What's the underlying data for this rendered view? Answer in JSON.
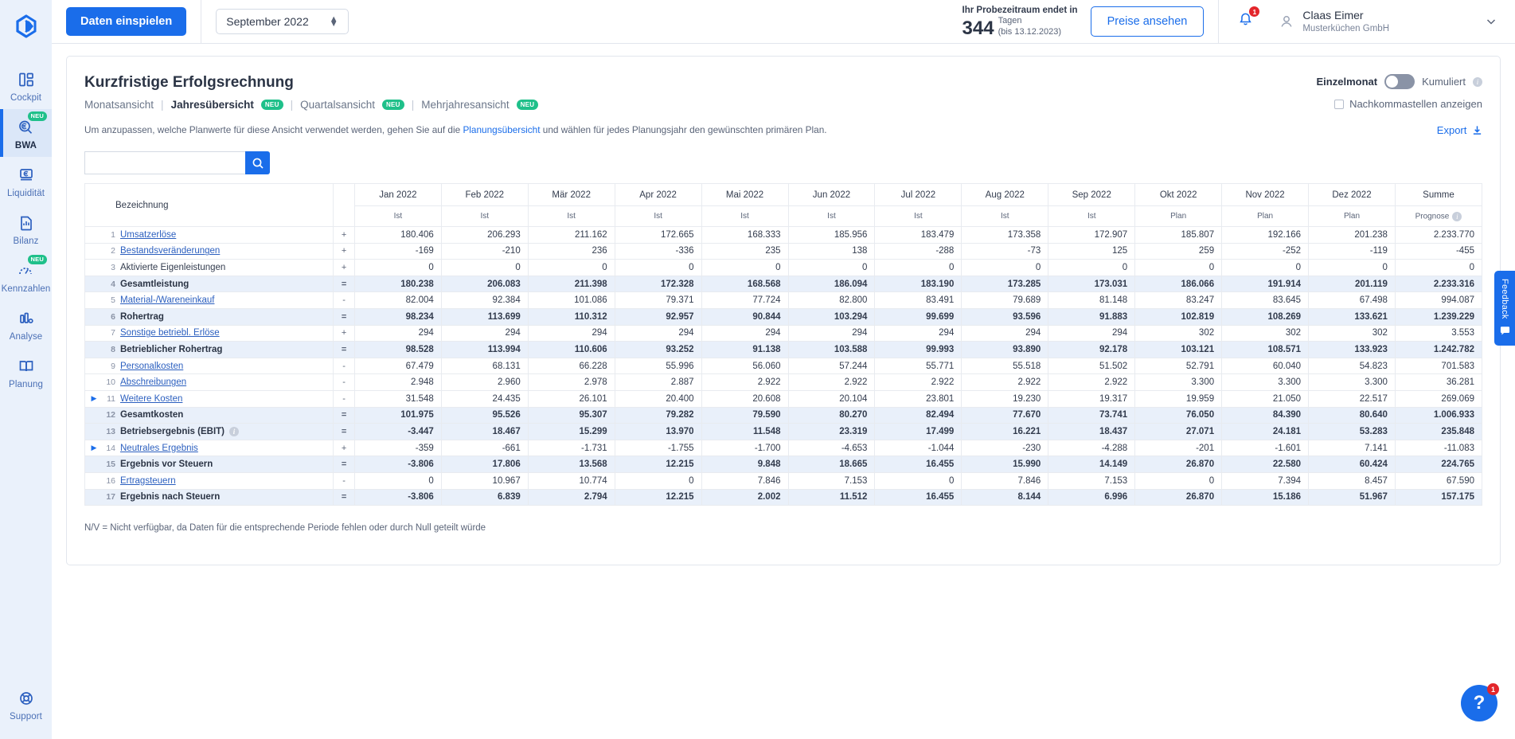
{
  "sidebar": {
    "logo": "agicap-logo",
    "items": [
      {
        "label": "Cockpit",
        "icon": "cockpit-icon",
        "badge": null,
        "active": false
      },
      {
        "label": "BWA",
        "icon": "bwa-magnifier-euro-icon",
        "badge": "NEU",
        "active": true
      },
      {
        "label": "Liquidität",
        "icon": "liquiditaet-atm-icon",
        "badge": null,
        "active": false
      },
      {
        "label": "Bilanz",
        "icon": "bilanz-document-icon",
        "badge": null,
        "active": false
      },
      {
        "label": "Kennzahlen",
        "icon": "kennzahlen-gauge-icon",
        "badge": "NEU",
        "active": false
      },
      {
        "label": "Analyse",
        "icon": "analyse-bars-icon",
        "badge": null,
        "active": false
      },
      {
        "label": "Planung",
        "icon": "planung-book-icon",
        "badge": null,
        "active": false
      }
    ],
    "support": {
      "label": "Support",
      "icon": "support-lifebuoy-icon"
    }
  },
  "topbar": {
    "import_button": "Daten einspielen",
    "month_select": "September 2022",
    "trial_heading": "Ihr Probezeitraum endet in",
    "trial_days": "344",
    "trial_unit": "Tagen",
    "trial_until": "(bis 13.12.2023)",
    "prices_button": "Preise ansehen",
    "bell_icon": "notification-bell-icon",
    "bell_count": "1",
    "avatar_icon": "user-avatar-icon",
    "user_name": "Claas Eimer",
    "user_org": "Musterküchen GmbH",
    "chevron": "chevron-down-icon"
  },
  "page": {
    "title": "Kurzfristige Erfolgsrechnung",
    "tabs": [
      {
        "label": "Monatsansicht",
        "badge": null,
        "active": false
      },
      {
        "label": "Jahresübersicht",
        "badge": "NEU",
        "active": true
      },
      {
        "label": "Quartalsansicht",
        "badge": "NEU",
        "active": false
      },
      {
        "label": "Mehrjahresansicht",
        "badge": "NEU",
        "active": false
      }
    ],
    "separator": "|",
    "hint_pre": "Um anzupassen, welche Planwerte für diese Ansicht verwendet werden, gehen Sie auf die ",
    "hint_link": "Planungsübersicht",
    "hint_post": " und wählen für jedes Planungsjahr den gewünschten primären Plan.",
    "toggle_left": "Einzelmonat",
    "toggle_right": "Kumuliert",
    "checkbox_label": "Nachkommastellen anzeigen",
    "export_label": "Export",
    "export_icon": "download-icon",
    "search_placeholder": "",
    "search_value": "",
    "search_icon": "search-icon",
    "footnote": "N/V = Nicht verfügbar, da Daten für die entsprechende Periode fehlen oder durch Null geteilt würde"
  },
  "table": {
    "name_header": "Bezeichnung",
    "columns": [
      {
        "label": "Jan 2022",
        "sub": "Ist"
      },
      {
        "label": "Feb 2022",
        "sub": "Ist"
      },
      {
        "label": "Mär 2022",
        "sub": "Ist"
      },
      {
        "label": "Apr 2022",
        "sub": "Ist"
      },
      {
        "label": "Mai 2022",
        "sub": "Ist"
      },
      {
        "label": "Jun 2022",
        "sub": "Ist"
      },
      {
        "label": "Jul 2022",
        "sub": "Ist"
      },
      {
        "label": "Aug 2022",
        "sub": "Ist"
      },
      {
        "label": "Sep 2022",
        "sub": "Ist"
      },
      {
        "label": "Okt 2022",
        "sub": "Plan"
      },
      {
        "label": "Nov 2022",
        "sub": "Plan"
      },
      {
        "label": "Dez 2022",
        "sub": "Plan"
      },
      {
        "label": "Summe",
        "sub": "Prognose"
      }
    ],
    "rows": [
      {
        "no": "1",
        "label": "Umsatzerlöse",
        "link": true,
        "sign": "+",
        "highlight": false,
        "expandable": false,
        "info": false,
        "values": [
          "180.406",
          "206.293",
          "211.162",
          "172.665",
          "168.333",
          "185.956",
          "183.479",
          "173.358",
          "172.907",
          "185.807",
          "192.166",
          "201.238",
          "2.233.770"
        ]
      },
      {
        "no": "2",
        "label": "Bestandsveränderungen",
        "link": true,
        "sign": "+",
        "highlight": false,
        "expandable": false,
        "info": false,
        "values": [
          "-169",
          "-210",
          "236",
          "-336",
          "235",
          "138",
          "-288",
          "-73",
          "125",
          "259",
          "-252",
          "-119",
          "-455"
        ]
      },
      {
        "no": "3",
        "label": "Aktivierte Eigenleistungen",
        "link": false,
        "sign": "+",
        "highlight": false,
        "expandable": false,
        "info": false,
        "values": [
          "0",
          "0",
          "0",
          "0",
          "0",
          "0",
          "0",
          "0",
          "0",
          "0",
          "0",
          "0",
          "0"
        ]
      },
      {
        "no": "4",
        "label": "Gesamtleistung",
        "link": false,
        "sign": "=",
        "highlight": true,
        "expandable": false,
        "info": false,
        "values": [
          "180.238",
          "206.083",
          "211.398",
          "172.328",
          "168.568",
          "186.094",
          "183.190",
          "173.285",
          "173.031",
          "186.066",
          "191.914",
          "201.119",
          "2.233.316"
        ]
      },
      {
        "no": "5",
        "label": "Material-/Wareneinkauf",
        "link": true,
        "sign": "-",
        "highlight": false,
        "expandable": false,
        "info": false,
        "values": [
          "82.004",
          "92.384",
          "101.086",
          "79.371",
          "77.724",
          "82.800",
          "83.491",
          "79.689",
          "81.148",
          "83.247",
          "83.645",
          "67.498",
          "994.087"
        ]
      },
      {
        "no": "6",
        "label": "Rohertrag",
        "link": false,
        "sign": "=",
        "highlight": true,
        "expandable": false,
        "info": false,
        "values": [
          "98.234",
          "113.699",
          "110.312",
          "92.957",
          "90.844",
          "103.294",
          "99.699",
          "93.596",
          "91.883",
          "102.819",
          "108.269",
          "133.621",
          "1.239.229"
        ]
      },
      {
        "no": "7",
        "label": "Sonstige betriebl. Erlöse",
        "link": true,
        "sign": "+",
        "highlight": false,
        "expandable": false,
        "info": false,
        "values": [
          "294",
          "294",
          "294",
          "294",
          "294",
          "294",
          "294",
          "294",
          "294",
          "302",
          "302",
          "302",
          "3.553"
        ]
      },
      {
        "no": "8",
        "label": "Betrieblicher Rohertrag",
        "link": false,
        "sign": "=",
        "highlight": true,
        "expandable": false,
        "info": false,
        "values": [
          "98.528",
          "113.994",
          "110.606",
          "93.252",
          "91.138",
          "103.588",
          "99.993",
          "93.890",
          "92.178",
          "103.121",
          "108.571",
          "133.923",
          "1.242.782"
        ]
      },
      {
        "no": "9",
        "label": "Personalkosten",
        "link": true,
        "sign": "-",
        "highlight": false,
        "expandable": false,
        "info": false,
        "values": [
          "67.479",
          "68.131",
          "66.228",
          "55.996",
          "56.060",
          "57.244",
          "55.771",
          "55.518",
          "51.502",
          "52.791",
          "60.040",
          "54.823",
          "701.583"
        ]
      },
      {
        "no": "10",
        "label": "Abschreibungen",
        "link": true,
        "sign": "-",
        "highlight": false,
        "expandable": false,
        "info": false,
        "values": [
          "2.948",
          "2.960",
          "2.978",
          "2.887",
          "2.922",
          "2.922",
          "2.922",
          "2.922",
          "2.922",
          "3.300",
          "3.300",
          "3.300",
          "36.281"
        ]
      },
      {
        "no": "11",
        "label": "Weitere Kosten",
        "link": true,
        "sign": "-",
        "highlight": false,
        "expandable": true,
        "info": false,
        "values": [
          "31.548",
          "24.435",
          "26.101",
          "20.400",
          "20.608",
          "20.104",
          "23.801",
          "19.230",
          "19.317",
          "19.959",
          "21.050",
          "22.517",
          "269.069"
        ]
      },
      {
        "no": "12",
        "label": "Gesamtkosten",
        "link": false,
        "sign": "=",
        "highlight": true,
        "expandable": false,
        "info": false,
        "values": [
          "101.975",
          "95.526",
          "95.307",
          "79.282",
          "79.590",
          "80.270",
          "82.494",
          "77.670",
          "73.741",
          "76.050",
          "84.390",
          "80.640",
          "1.006.933"
        ]
      },
      {
        "no": "13",
        "label": "Betriebsergebnis (EBIT)",
        "link": false,
        "sign": "=",
        "highlight": true,
        "expandable": false,
        "info": true,
        "values": [
          "-3.447",
          "18.467",
          "15.299",
          "13.970",
          "11.548",
          "23.319",
          "17.499",
          "16.221",
          "18.437",
          "27.071",
          "24.181",
          "53.283",
          "235.848"
        ]
      },
      {
        "no": "14",
        "label": "Neutrales Ergebnis",
        "link": true,
        "sign": "+",
        "highlight": false,
        "expandable": true,
        "info": false,
        "values": [
          "-359",
          "-661",
          "-1.731",
          "-1.755",
          "-1.700",
          "-4.653",
          "-1.044",
          "-230",
          "-4.288",
          "-201",
          "-1.601",
          "7.141",
          "-11.083"
        ]
      },
      {
        "no": "15",
        "label": "Ergebnis vor Steuern",
        "link": false,
        "sign": "=",
        "highlight": true,
        "expandable": false,
        "info": false,
        "values": [
          "-3.806",
          "17.806",
          "13.568",
          "12.215",
          "9.848",
          "18.665",
          "16.455",
          "15.990",
          "14.149",
          "26.870",
          "22.580",
          "60.424",
          "224.765"
        ]
      },
      {
        "no": "16",
        "label": "Ertragsteuern",
        "link": true,
        "sign": "-",
        "highlight": false,
        "expandable": false,
        "info": false,
        "values": [
          "0",
          "10.967",
          "10.774",
          "0",
          "7.846",
          "7.153",
          "0",
          "7.846",
          "7.153",
          "0",
          "7.394",
          "8.457",
          "67.590"
        ]
      },
      {
        "no": "17",
        "label": "Ergebnis nach Steuern",
        "link": false,
        "sign": "=",
        "highlight": true,
        "expandable": false,
        "info": false,
        "values": [
          "-3.806",
          "6.839",
          "2.794",
          "12.215",
          "2.002",
          "11.512",
          "16.455",
          "8.144",
          "6.996",
          "26.870",
          "15.186",
          "51.967",
          "157.175"
        ]
      }
    ]
  },
  "feedback": {
    "label": "Feedback",
    "icon": "feedback-speech-icon"
  },
  "help": {
    "label": "?",
    "badge": "1"
  },
  "colors": {
    "brand_blue": "#1a6dea",
    "sidebar_bg": "#eaf1fb",
    "badge_green": "#1fc08a",
    "badge_red": "#e3262b",
    "row_highlight": "#e9f0fa"
  }
}
